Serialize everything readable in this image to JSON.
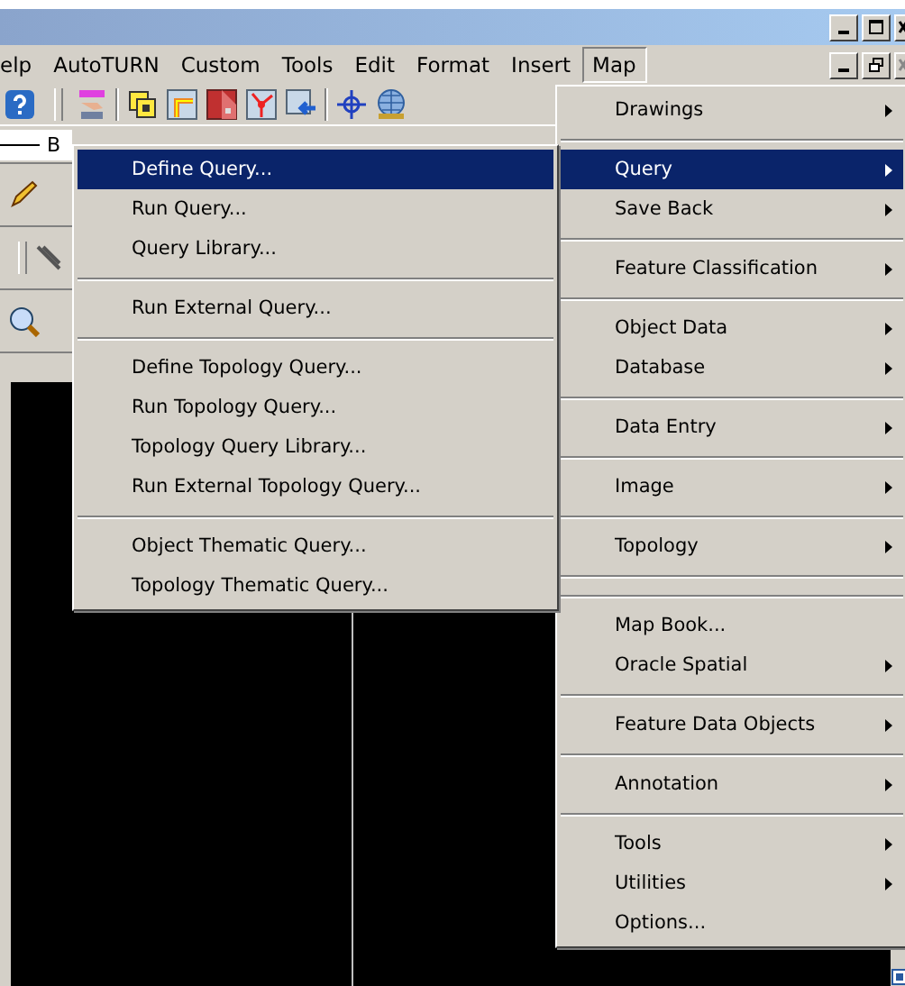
{
  "menu_bar": {
    "items": [
      {
        "label": "elp",
        "selected": false
      },
      {
        "label": "AutoTURN",
        "selected": false
      },
      {
        "label": "Custom",
        "selected": false
      },
      {
        "label": "Tools",
        "selected": false
      },
      {
        "label": "Edit",
        "selected": false
      },
      {
        "label": "Format",
        "selected": false
      },
      {
        "label": "Insert",
        "selected": false
      },
      {
        "label": "Map",
        "selected": true
      }
    ]
  },
  "side_panel": {
    "label": "B"
  },
  "map_menu": {
    "items": [
      {
        "kind": "item",
        "label": "Drawings",
        "has_submenu": true,
        "selected": false
      },
      {
        "kind": "separator"
      },
      {
        "kind": "item",
        "label": "Query",
        "has_submenu": true,
        "selected": true
      },
      {
        "kind": "item",
        "label": "Save Back",
        "has_submenu": true,
        "selected": false
      },
      {
        "kind": "separator"
      },
      {
        "kind": "item",
        "label": "Feature Classification",
        "has_submenu": true,
        "selected": false
      },
      {
        "kind": "separator"
      },
      {
        "kind": "item",
        "label": "Object Data",
        "has_submenu": true,
        "selected": false
      },
      {
        "kind": "item",
        "label": "Database",
        "has_submenu": true,
        "selected": false
      },
      {
        "kind": "separator"
      },
      {
        "kind": "item",
        "label": "Data Entry",
        "has_submenu": true,
        "selected": false
      },
      {
        "kind": "separator"
      },
      {
        "kind": "item",
        "label": "Image",
        "has_submenu": true,
        "selected": false
      },
      {
        "kind": "separator"
      },
      {
        "kind": "item",
        "label": "Topology",
        "has_submenu": true,
        "selected": false
      },
      {
        "kind": "separator"
      },
      {
        "kind": "separator"
      },
      {
        "kind": "item",
        "label": "Map Book...",
        "has_submenu": false,
        "selected": false
      },
      {
        "kind": "item",
        "label": "Oracle Spatial",
        "has_submenu": true,
        "selected": false
      },
      {
        "kind": "separator"
      },
      {
        "kind": "item",
        "label": "Feature Data Objects",
        "has_submenu": true,
        "selected": false
      },
      {
        "kind": "separator"
      },
      {
        "kind": "item",
        "label": "Annotation",
        "has_submenu": true,
        "selected": false
      },
      {
        "kind": "separator"
      },
      {
        "kind": "item",
        "label": "Tools",
        "has_submenu": true,
        "selected": false
      },
      {
        "kind": "item",
        "label": "Utilities",
        "has_submenu": true,
        "selected": false
      },
      {
        "kind": "item",
        "label": "Options...",
        "has_submenu": false,
        "selected": false
      }
    ]
  },
  "query_menu": {
    "items": [
      {
        "kind": "item",
        "label": "Define Query...",
        "has_submenu": false,
        "selected": true
      },
      {
        "kind": "item",
        "label": "Run Query...",
        "has_submenu": false,
        "selected": false
      },
      {
        "kind": "item",
        "label": "Query Library...",
        "has_submenu": false,
        "selected": false
      },
      {
        "kind": "separator"
      },
      {
        "kind": "item",
        "label": "Run External Query...",
        "has_submenu": false,
        "selected": false
      },
      {
        "kind": "separator"
      },
      {
        "kind": "item",
        "label": "Define Topology Query...",
        "has_submenu": false,
        "selected": false
      },
      {
        "kind": "item",
        "label": "Run Topology Query...",
        "has_submenu": false,
        "selected": false
      },
      {
        "kind": "item",
        "label": "Topology Query Library...",
        "has_submenu": false,
        "selected": false
      },
      {
        "kind": "item",
        "label": "Run External Topology Query...",
        "has_submenu": false,
        "selected": false
      },
      {
        "kind": "separator"
      },
      {
        "kind": "item",
        "label": "Object Thematic Query...",
        "has_submenu": false,
        "selected": false
      },
      {
        "kind": "item",
        "label": "Topology Thematic Query...",
        "has_submenu": false,
        "selected": false
      }
    ]
  }
}
